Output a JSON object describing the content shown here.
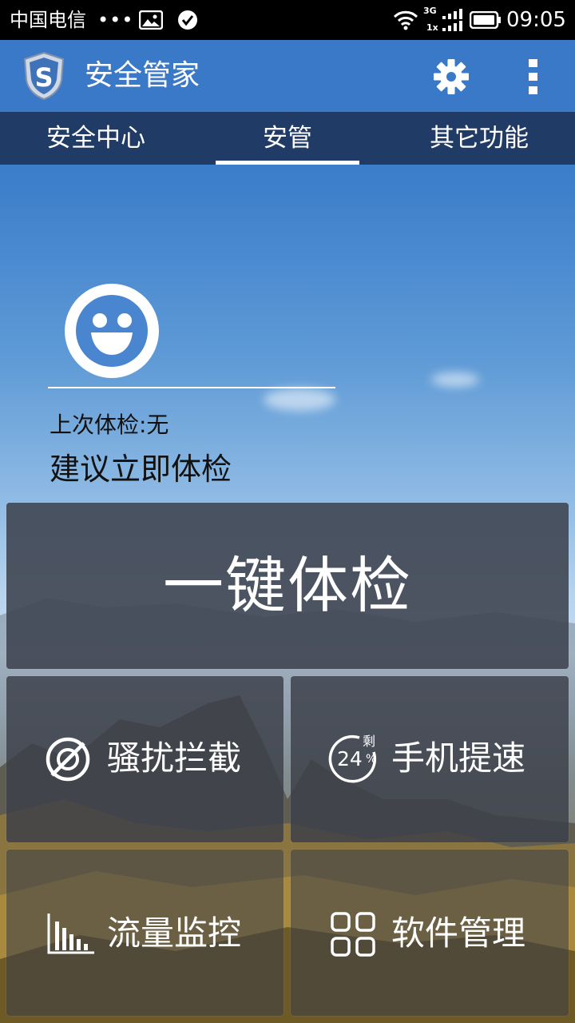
{
  "status_bar": {
    "carrier": "中国电信",
    "dots": "•••",
    "network": "3G",
    "network_sub": "1x",
    "time": "09:05"
  },
  "app_bar": {
    "title": "安全管家",
    "icons": [
      "shield-s-logo",
      "gear-icon",
      "overflow-menu-icon"
    ]
  },
  "tabs": [
    {
      "label": "安全中心",
      "selected": false
    },
    {
      "label": "安管",
      "selected": true
    },
    {
      "label": "其它功能",
      "selected": false
    }
  ],
  "summary": {
    "last_check": "上次体检:无",
    "suggestion": "建议立即体检",
    "face_icon": "smiley-face-icon"
  },
  "scan_button": {
    "label": "一键体检"
  },
  "tiles": [
    {
      "label": "骚扰拦截",
      "icon": "block-icon"
    },
    {
      "label": "手机提速",
      "icon": "speedup-gauge-icon",
      "badge_text": "剩",
      "percent": "24",
      "percent_sign": "%"
    },
    {
      "label": "流量监控",
      "icon": "bar-chart-icon"
    },
    {
      "label": "软件管理",
      "icon": "app-grid-icon"
    }
  ]
}
